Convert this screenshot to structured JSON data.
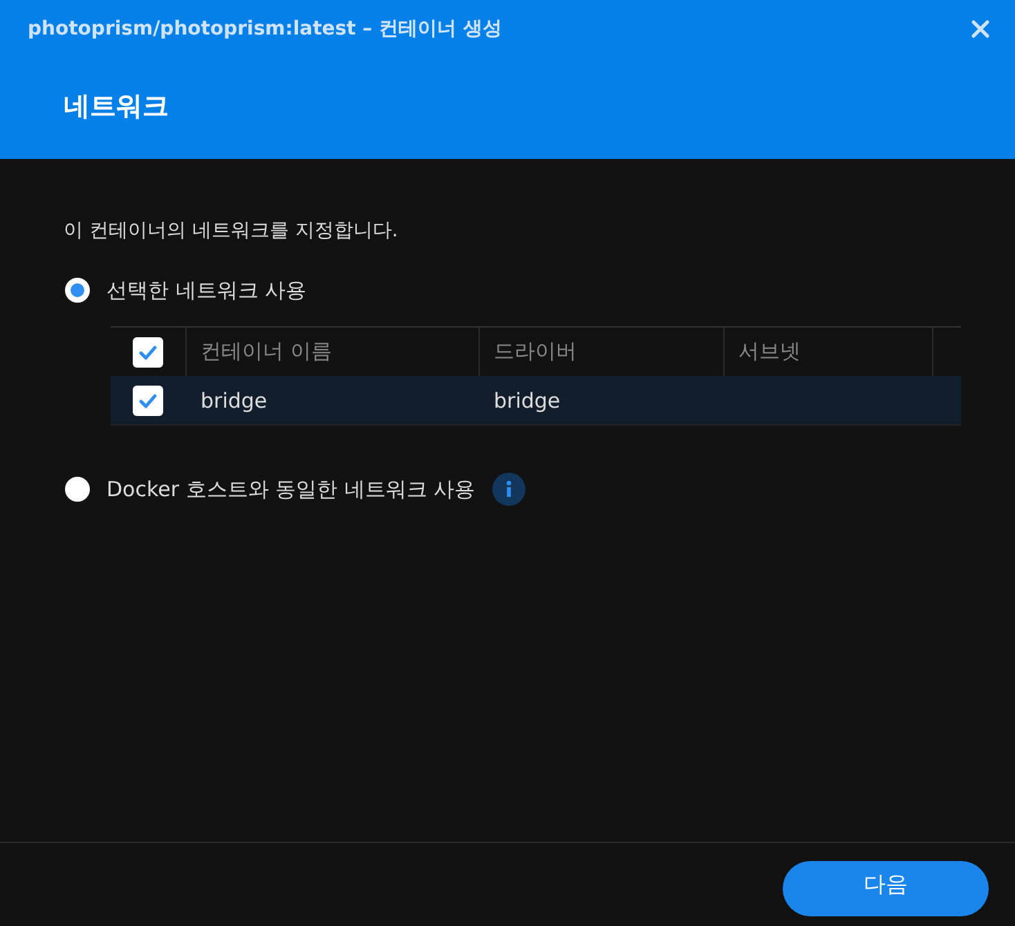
{
  "window": {
    "title": "photoprism/photoprism:latest – 컨테이너 생성"
  },
  "heading": "네트워크",
  "description": "이 컨테이너의 네트워크를 지정합니다.",
  "options": [
    {
      "label": "선택한 네트워크 사용",
      "selected": true,
      "kind": "table"
    },
    {
      "label": "Docker 호스트와 동일한 네트워크 사용",
      "selected": false,
      "kind": "info"
    }
  ],
  "table": {
    "all_checked": true,
    "columns": [
      "컨테이너 이름",
      "드라이버",
      "서브넷"
    ],
    "rows": [
      {
        "checked": true,
        "cells": [
          "bridge",
          "bridge",
          ""
        ]
      }
    ]
  },
  "buttons": [
    "다음"
  ]
}
